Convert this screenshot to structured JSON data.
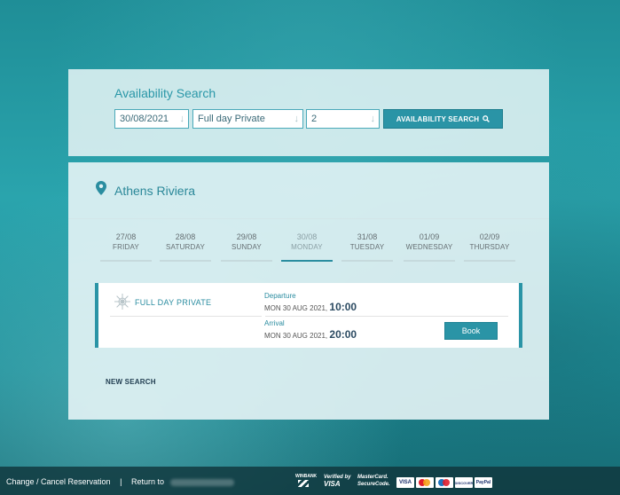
{
  "search": {
    "title": "Availability Search",
    "date_value": "30/08/2021",
    "tour_value": "Full day Private",
    "pax_value": "2",
    "button_label": "AVAILABILITY SEARCH"
  },
  "location": {
    "name": "Athens Riviera"
  },
  "days": [
    {
      "date": "27/08",
      "weekday": "FRIDAY",
      "active": false
    },
    {
      "date": "28/08",
      "weekday": "SATURDAY",
      "active": false
    },
    {
      "date": "29/08",
      "weekday": "SUNDAY",
      "active": false
    },
    {
      "date": "30/08",
      "weekday": "MONDAY",
      "active": true
    },
    {
      "date": "31/08",
      "weekday": "TUESDAY",
      "active": false
    },
    {
      "date": "01/09",
      "weekday": "WEDNESDAY",
      "active": false
    },
    {
      "date": "02/09",
      "weekday": "THURSDAY",
      "active": false
    }
  ],
  "tour": {
    "name": "FULL DAY PRIVATE",
    "departure_label": "Departure",
    "departure_date": "MON 30 AUG 2021,",
    "departure_time": "10:00",
    "arrival_label": "Arrival",
    "arrival_date": "MON 30 AUG 2021,",
    "arrival_time": "20:00",
    "book_label": "Book"
  },
  "new_search_label": "NEW SEARCH",
  "footer": {
    "change_cancel": "Change / Cancel Reservation",
    "separator": "|",
    "return_to": "Return to",
    "payments": {
      "winbank": "WINBANK",
      "vbv_line1": "Verified by",
      "vbv_line2": "VISA",
      "mc_line1": "MasterCard.",
      "mc_line2": "SecureCode.",
      "visa": "VISA",
      "discover": "DISCOVER",
      "paypal": "PayPal"
    }
  },
  "colors": {
    "accent": "#2a94a6",
    "title": "#2a97a8",
    "footer_bg": "#10363c"
  }
}
